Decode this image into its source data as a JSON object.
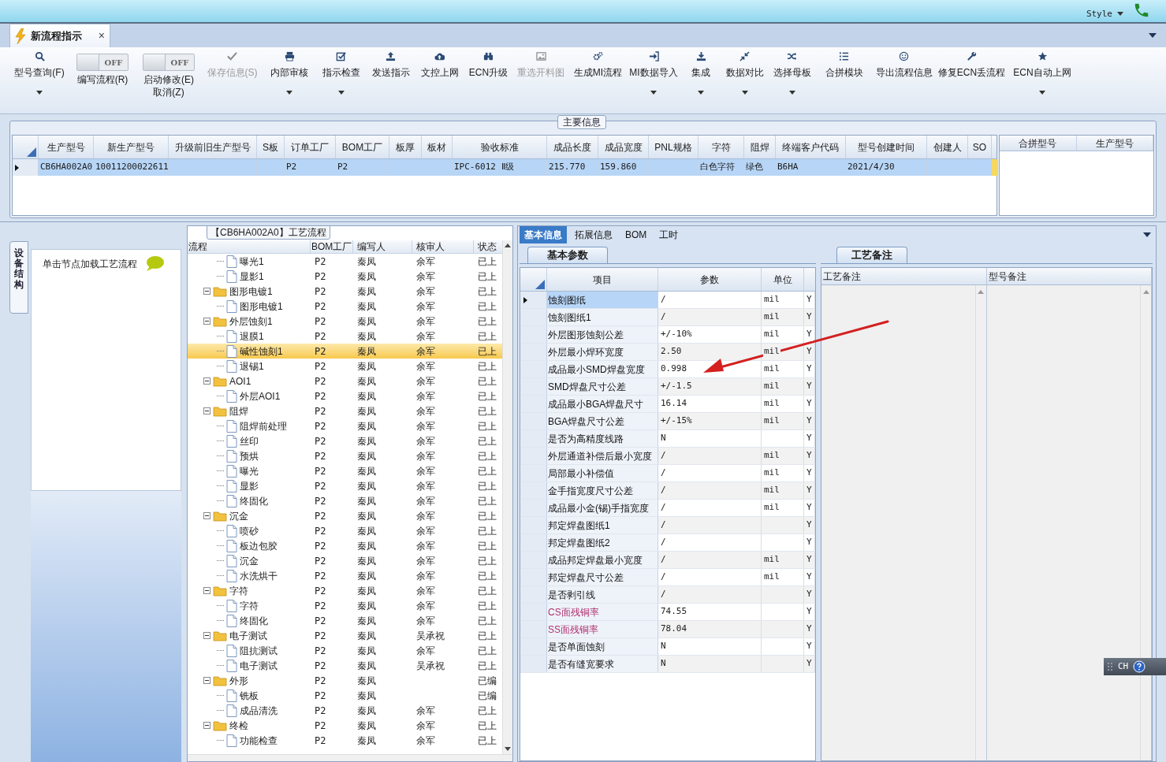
{
  "top_bar": {
    "style_menu": "Style"
  },
  "document_tab": {
    "title": "新流程指示",
    "close": "×",
    "selected": true
  },
  "toolbar": [
    {
      "kind": "button",
      "label": "型号查询(F)",
      "disabled": false,
      "dropdown": true
    },
    {
      "kind": "toggle",
      "lines": [
        "编写流程(R)"
      ],
      "toggle_text": "OFF",
      "on": false
    },
    {
      "kind": "toggle",
      "lines": [
        "启动修改(E)",
        "取消(Z)"
      ],
      "toggle_text": "OFF",
      "on": false
    },
    {
      "kind": "button",
      "label": "保存信息(S)",
      "disabled": true,
      "dropdown": false
    },
    {
      "kind": "button",
      "label": "内部审核",
      "disabled": false,
      "dropdown": true
    },
    {
      "kind": "button",
      "label": "指示检查",
      "disabled": false,
      "dropdown": true
    },
    {
      "kind": "button",
      "label": "发送指示",
      "disabled": false,
      "dropdown": false
    },
    {
      "kind": "button",
      "label": "文控上网",
      "disabled": false,
      "dropdown": false
    },
    {
      "kind": "button",
      "label": "ECN升级",
      "disabled": false,
      "dropdown": false
    },
    {
      "kind": "button",
      "label": "重选开料图",
      "disabled": true,
      "dropdown": false
    },
    {
      "kind": "button",
      "label": "生成MI流程",
      "disabled": false,
      "dropdown": false
    },
    {
      "kind": "button",
      "label": "MI数据导入",
      "disabled": false,
      "dropdown": true
    },
    {
      "kind": "button",
      "label": "集成",
      "disabled": false,
      "dropdown": true
    },
    {
      "kind": "button",
      "label": "数据对比",
      "disabled": false,
      "dropdown": true
    },
    {
      "kind": "button",
      "label": "选择母板",
      "disabled": false,
      "dropdown": true
    },
    {
      "kind": "button",
      "label": "合拼模块",
      "disabled": false,
      "dropdown": false
    },
    {
      "kind": "button",
      "label": "导出流程信息",
      "disabled": false,
      "dropdown": false
    },
    {
      "kind": "button",
      "label": "修复ECN丢流程",
      "disabled": false,
      "dropdown": false
    },
    {
      "kind": "button",
      "label": "ECN自动上网",
      "disabled": false,
      "dropdown": true
    }
  ],
  "main_info": {
    "title": "主要信息",
    "columns": [
      "生产型号",
      "新生产型号",
      "升级前旧生产型号",
      "S板",
      "订单工厂",
      "BOM工厂",
      "板厚",
      "板材",
      "验收标准",
      "成品长度",
      "成品宽度",
      "PNL规格",
      "字符",
      "阻焊",
      "终端客户代码",
      "型号创建时间",
      "创建人",
      "SO"
    ],
    "rows": [
      {
        "selected": true,
        "cells": [
          "CB6HA002A0",
          "10011200022611",
          null,
          null,
          "P2",
          "P2",
          null,
          null,
          "IPC-6012 Ⅱ级",
          "215.770",
          "159.860",
          null,
          "白色字符",
          "绿色",
          "B6HA",
          "2021/4/30",
          null,
          null
        ]
      }
    ]
  },
  "merge_table": {
    "columns": [
      "合拼型号",
      "生产型号"
    ]
  },
  "left_panel": {
    "side_tab": "设备结构",
    "hint": "单击节点加载工艺流程"
  },
  "process_panel": {
    "title": "【CB6HA002A0】工艺流程",
    "columns": [
      "流程",
      "BOM工厂",
      "编写人",
      "核审人",
      "状态"
    ],
    "nodes": [
      {
        "children": [
          {
            "label": "曝光1",
            "bom": "P2",
            "writer": "秦凤",
            "reviewer": "余军",
            "status": "已上",
            "selected": false
          },
          {
            "label": "显影1",
            "bom": "P2",
            "writer": "秦凤",
            "reviewer": "余军",
            "status": "已上",
            "selected": false
          }
        ]
      },
      {
        "label": "图形电镀1",
        "bom": "P2",
        "writer": "秦凤",
        "reviewer": "余军",
        "status": "已上",
        "selected": false,
        "expanded": true,
        "children": [
          {
            "label": "图形电镀1",
            "bom": "P2",
            "writer": "秦凤",
            "reviewer": "余军",
            "status": "已上",
            "selected": false
          }
        ]
      },
      {
        "label": "外层蚀刻1",
        "bom": "P2",
        "writer": "秦凤",
        "reviewer": "余军",
        "status": "已上",
        "selected": false,
        "expanded": true,
        "children": [
          {
            "label": "退膜1",
            "bom": "P2",
            "writer": "秦凤",
            "reviewer": "余军",
            "status": "已上",
            "selected": false
          },
          {
            "label": "碱性蚀刻1",
            "bom": "P2",
            "writer": "秦凤",
            "reviewer": "余军",
            "status": "已上",
            "selected": true
          },
          {
            "label": "退锡1",
            "bom": "P2",
            "writer": "秦凤",
            "reviewer": "余军",
            "status": "已上",
            "selected": false
          }
        ]
      },
      {
        "label": "AOI1",
        "bom": "P2",
        "writer": "秦凤",
        "reviewer": "余军",
        "status": "已上",
        "selected": false,
        "expanded": true,
        "children": [
          {
            "label": "外层AOI1",
            "bom": "P2",
            "writer": "秦凤",
            "reviewer": "余军",
            "status": "已上",
            "selected": false
          }
        ]
      },
      {
        "label": "阻焊",
        "bom": "P2",
        "writer": "秦凤",
        "reviewer": "余军",
        "status": "已上",
        "selected": false,
        "expanded": true,
        "children": [
          {
            "label": "阻焊前处理",
            "bom": "P2",
            "writer": "秦凤",
            "reviewer": "余军",
            "status": "已上",
            "selected": false
          },
          {
            "label": "丝印",
            "bom": "P2",
            "writer": "秦凤",
            "reviewer": "余军",
            "status": "已上",
            "selected": false
          },
          {
            "label": "预烘",
            "bom": "P2",
            "writer": "秦凤",
            "reviewer": "余军",
            "status": "已上",
            "selected": false
          },
          {
            "label": "曝光",
            "bom": "P2",
            "writer": "秦凤",
            "reviewer": "余军",
            "status": "已上",
            "selected": false
          },
          {
            "label": "显影",
            "bom": "P2",
            "writer": "秦凤",
            "reviewer": "余军",
            "status": "已上",
            "selected": false
          },
          {
            "label": "终固化",
            "bom": "P2",
            "writer": "秦凤",
            "reviewer": "余军",
            "status": "已上",
            "selected": false
          }
        ]
      },
      {
        "label": "沉金",
        "bom": "P2",
        "writer": "秦凤",
        "reviewer": "余军",
        "status": "已上",
        "selected": false,
        "expanded": true,
        "children": [
          {
            "label": "喷砂",
            "bom": "P2",
            "writer": "秦凤",
            "reviewer": "余军",
            "status": "已上",
            "selected": false
          },
          {
            "label": "板边包胶",
            "bom": "P2",
            "writer": "秦凤",
            "reviewer": "余军",
            "status": "已上",
            "selected": false
          },
          {
            "label": "沉金",
            "bom": "P2",
            "writer": "秦凤",
            "reviewer": "余军",
            "status": "已上",
            "selected": false
          },
          {
            "label": "水洗烘干",
            "bom": "P2",
            "writer": "秦凤",
            "reviewer": "余军",
            "status": "已上",
            "selected": false
          }
        ]
      },
      {
        "label": "字符",
        "bom": "P2",
        "writer": "秦凤",
        "reviewer": "余军",
        "status": "已上",
        "selected": false,
        "expanded": true,
        "children": [
          {
            "label": "字符",
            "bom": "P2",
            "writer": "秦凤",
            "reviewer": "余军",
            "status": "已上",
            "selected": false
          },
          {
            "label": "终固化",
            "bom": "P2",
            "writer": "秦凤",
            "reviewer": "余军",
            "status": "已上",
            "selected": false
          }
        ]
      },
      {
        "label": "电子测试",
        "bom": "P2",
        "writer": "秦凤",
        "reviewer": "吴承祝",
        "status": "已上",
        "selected": false,
        "expanded": true,
        "children": [
          {
            "label": "阻抗测试",
            "bom": "P2",
            "writer": "秦凤",
            "reviewer": "余军",
            "status": "已上",
            "selected": false
          },
          {
            "label": "电子测试",
            "bom": "P2",
            "writer": "秦凤",
            "reviewer": "吴承祝",
            "status": "已上",
            "selected": false
          }
        ]
      },
      {
        "label": "外形",
        "bom": "P2",
        "writer": "秦凤",
        "status": "已编",
        "selected": false,
        "expanded": true,
        "children": [
          {
            "label": "铣板",
            "bom": "P2",
            "writer": "秦凤",
            "status": "已编",
            "selected": false
          },
          {
            "label": "成品清洗",
            "bom": "P2",
            "writer": "秦凤",
            "reviewer": "余军",
            "status": "已上",
            "selected": false
          }
        ]
      },
      {
        "label": "终检",
        "bom": "P2",
        "writer": "秦凤",
        "reviewer": "余军",
        "status": "已上",
        "selected": false,
        "expanded": true,
        "children": [
          {
            "label": "功能检查",
            "bom": "P2",
            "writer": "秦凤",
            "reviewer": "余军",
            "status": "已上",
            "selected": false
          }
        ]
      }
    ]
  },
  "detail_tabs": [
    {
      "label": "基本信息",
      "selected": true
    },
    {
      "label": "拓展信息",
      "selected": false
    },
    {
      "label": "BOM",
      "selected": false
    },
    {
      "label": "工时",
      "selected": false
    }
  ],
  "params": {
    "title": "基本参数",
    "columns": [
      "项目",
      "参数",
      "单位"
    ],
    "rows": [
      {
        "item": "蚀刻图纸",
        "value": "/",
        "unit": "mil",
        "column_4": "Y",
        "flagged": false,
        "selected": true
      },
      {
        "item": "蚀刻图纸1",
        "value": "/",
        "unit": "mil",
        "column_4": "Y",
        "flagged": false,
        "selected": false
      },
      {
        "item": "外层图形蚀刻公差",
        "value": "+/-10%",
        "unit": "mil",
        "column_4": "Y",
        "flagged": false,
        "selected": false
      },
      {
        "item": "外层最小焊环宽度",
        "value": "2.50",
        "unit": "mil",
        "column_4": "Y",
        "flagged": false,
        "selected": false
      },
      {
        "item": "成品最小SMD焊盘宽度",
        "value": "0.998",
        "unit": "mil",
        "column_4": "Y",
        "flagged": false,
        "selected": false
      },
      {
        "item": "SMD焊盘尺寸公差",
        "value": "+/-1.5",
        "unit": "mil",
        "column_4": "Y",
        "flagged": false,
        "selected": false
      },
      {
        "item": "成品最小BGA焊盘尺寸",
        "value": "16.14",
        "unit": "mil",
        "column_4": "Y",
        "flagged": false,
        "selected": false
      },
      {
        "item": "BGA焊盘尺寸公差",
        "value": "+/-15%",
        "unit": "mil",
        "column_4": "Y",
        "flagged": false,
        "selected": false
      },
      {
        "item": "是否为高精度线路",
        "value": "N",
        "column_4": "Y",
        "flagged": false,
        "selected": false
      },
      {
        "item": "外层通道补偿后最小宽度",
        "value": "/",
        "unit": "mil",
        "column_4": "Y",
        "flagged": false,
        "selected": false
      },
      {
        "item": "局部最小补偿值",
        "value": "/",
        "unit": "mil",
        "column_4": "Y",
        "flagged": false,
        "selected": false
      },
      {
        "item": "金手指宽度尺寸公差",
        "value": "/",
        "unit": "mil",
        "column_4": "Y",
        "flagged": false,
        "selected": false
      },
      {
        "item": "成品最小金(锡)手指宽度",
        "value": "/",
        "unit": "mil",
        "column_4": "Y",
        "flagged": false,
        "selected": false
      },
      {
        "item": "邦定焊盘图纸1",
        "value": "/",
        "column_4": "Y",
        "flagged": false,
        "selected": false
      },
      {
        "item": "邦定焊盘图纸2",
        "value": "/",
        "column_4": "Y",
        "flagged": false,
        "selected": false
      },
      {
        "item": "成品邦定焊盘最小宽度",
        "value": "/",
        "unit": "mil",
        "column_4": "Y",
        "flagged": false,
        "selected": false
      },
      {
        "item": "邦定焊盘尺寸公差",
        "value": "/",
        "unit": "mil",
        "column_4": "Y",
        "flagged": false,
        "selected": false
      },
      {
        "item": "是否剥引线",
        "value": "/",
        "column_4": "Y",
        "flagged": false,
        "selected": false
      },
      {
        "item": "CS面残铜率",
        "value": "74.55",
        "column_4": "Y",
        "flagged": true,
        "selected": false
      },
      {
        "item": "SS面残铜率",
        "value": "78.04",
        "column_4": "Y",
        "flagged": true,
        "selected": false
      },
      {
        "item": "是否单面蚀刻",
        "value": "N",
        "column_4": "Y",
        "flagged": false,
        "selected": false
      },
      {
        "item": "是否有缝宽要求",
        "value": "N",
        "column_4": "Y",
        "flagged": false,
        "selected": false
      }
    ]
  },
  "remarks": {
    "title": "工艺备注",
    "columns": [
      "工艺备注",
      "型号备注"
    ]
  },
  "input_indicator": {
    "label": "CH"
  }
}
